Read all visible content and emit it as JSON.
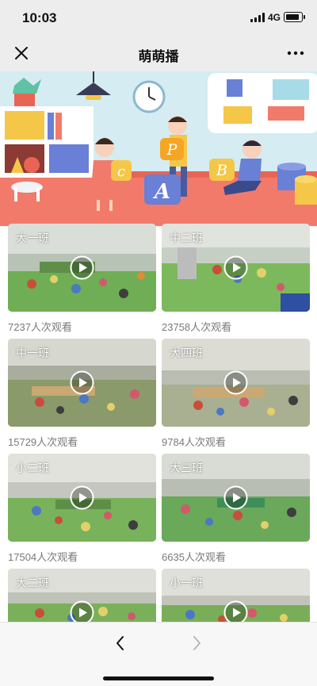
{
  "status_bar": {
    "time": "10:03",
    "network": "4G"
  },
  "nav_bar": {
    "title": "萌萌播",
    "close_icon": "close-icon",
    "more_icon": "more-icon"
  },
  "banner": {
    "letters": [
      "c",
      "P",
      "A",
      "B"
    ],
    "colors": {
      "wall": "#cfe8f0",
      "floor": "#f27a6b",
      "accent": "#5b7bd5"
    }
  },
  "videos": [
    {
      "class_name": "大一班",
      "views": "7237人次观看"
    },
    {
      "class_name": "中二班",
      "views": "23758人次观看"
    },
    {
      "class_name": "中一班",
      "views": "15729人次观看"
    },
    {
      "class_name": "大四班",
      "views": "9784人次观看"
    },
    {
      "class_name": "小二班",
      "views": "17504人次观看"
    },
    {
      "class_name": "大三班",
      "views": "6635人次观看"
    },
    {
      "class_name": "大二班",
      "views": ""
    },
    {
      "class_name": "小一班",
      "views": ""
    }
  ],
  "bottom_bar": {
    "back_icon": "chevron-left-icon",
    "forward_icon": "chevron-right-icon"
  }
}
